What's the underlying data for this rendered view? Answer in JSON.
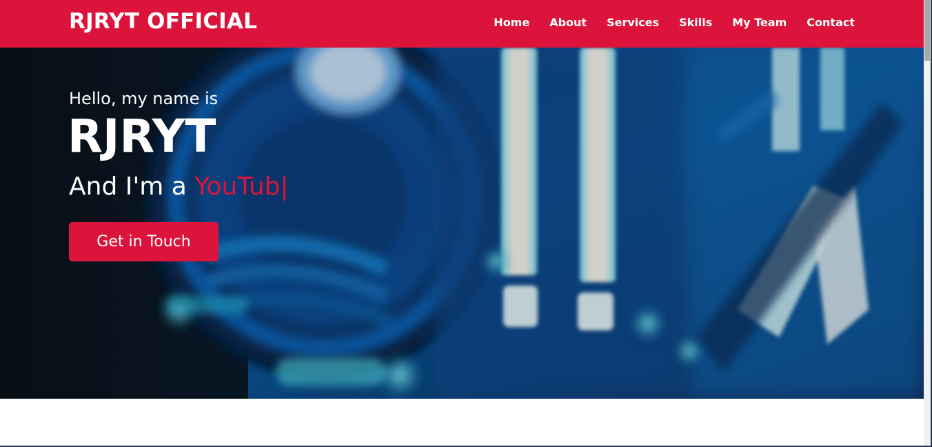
{
  "nav": {
    "brand": "RJRYT OFFICIAL",
    "items": [
      {
        "label": "Home"
      },
      {
        "label": "About"
      },
      {
        "label": "Services"
      },
      {
        "label": "Skills"
      },
      {
        "label": "My Team"
      },
      {
        "label": "Contact"
      }
    ]
  },
  "hero": {
    "greeting": "Hello, my name is",
    "name": "RJRYT",
    "role_prefix": "And I'm a ",
    "role_typed": "YouTub",
    "cursor": "|",
    "cta_label": "Get in Touch"
  },
  "colors": {
    "accent": "#dc143c",
    "text_light": "#ffffff"
  }
}
